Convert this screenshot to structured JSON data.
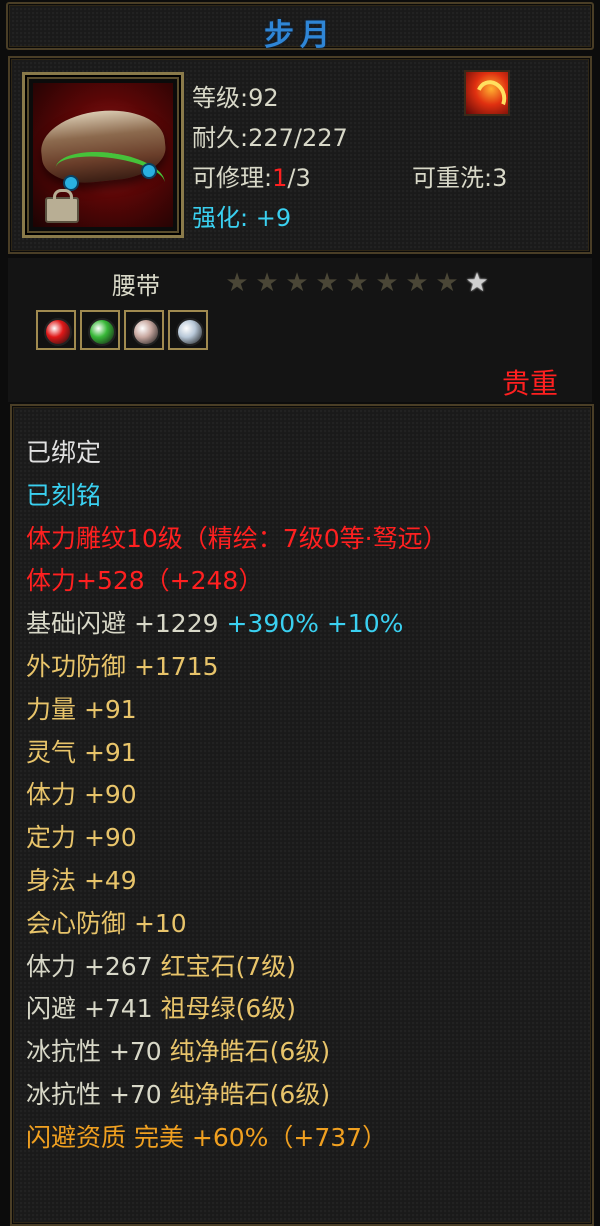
{
  "item": {
    "title": "步月",
    "level_label": "等级",
    "level": "92",
    "durability_label": "耐久",
    "durability": "227/227",
    "repair_label": "可修理",
    "repair_used": "1",
    "repair_total": "/3",
    "rewash_label": "可重洗",
    "rewash": "3",
    "enhance_label": "强化",
    "enhance": "+9",
    "type": "腰带",
    "stars_total": 9,
    "stars_lit": 1,
    "rarity": "贵重",
    "slot_colors": [
      "#e01818",
      "#38b838",
      "#c8a8a0",
      "#b8c8d8"
    ]
  },
  "colors": {
    "white": "#d8d8c8",
    "cyan": "#3ad0f0",
    "red": "#ff2020",
    "gold": "#e8c46a",
    "orange": "#f0a020"
  },
  "attributes": [
    {
      "text": "已绑定",
      "color": "#e0e0e0"
    },
    {
      "text": "已刻铭",
      "color": "#3ad0f0"
    },
    {
      "text": "体力雕纹10级（精绘：7级0等·驽远）",
      "color": "#ff2020"
    },
    {
      "text": "体力+528（+248）",
      "color": "#ff2020"
    },
    {
      "parts": [
        {
          "text": "基础闪避 +1229 ",
          "color": "#d8d8c8"
        },
        {
          "text": "+390% +10%",
          "color": "#3ad0f0"
        }
      ]
    },
    {
      "text": "外功防御 +1715",
      "color": "#e8c46a"
    },
    {
      "text": "力量 +91",
      "color": "#e8c46a"
    },
    {
      "text": "灵气 +91",
      "color": "#e8c46a"
    },
    {
      "text": "体力 +90",
      "color": "#e8c46a"
    },
    {
      "text": "定力 +90",
      "color": "#e8c46a"
    },
    {
      "text": "身法 +49",
      "color": "#e8c46a"
    },
    {
      "text": "会心防御 +10",
      "color": "#e8c46a"
    },
    {
      "parts": [
        {
          "text": "体力 +267 ",
          "color": "#d8d8c8"
        },
        {
          "text": "红宝石(7级)",
          "color": "#e8c46a"
        }
      ]
    },
    {
      "parts": [
        {
          "text": "闪避 +741 ",
          "color": "#d8d8c8"
        },
        {
          "text": "祖母绿(6级)",
          "color": "#e8c46a"
        }
      ]
    },
    {
      "parts": [
        {
          "text": "冰抗性 +70 ",
          "color": "#d8d8c8"
        },
        {
          "text": "纯净皓石(6级)",
          "color": "#e8c46a"
        }
      ]
    },
    {
      "parts": [
        {
          "text": "冰抗性 +70 ",
          "color": "#d8d8c8"
        },
        {
          "text": "纯净皓石(6级)",
          "color": "#e8c46a"
        }
      ]
    },
    {
      "parts": [
        {
          "text": "闪避资质 完美 +60%（+737）",
          "color": "#f0a020"
        }
      ]
    }
  ]
}
